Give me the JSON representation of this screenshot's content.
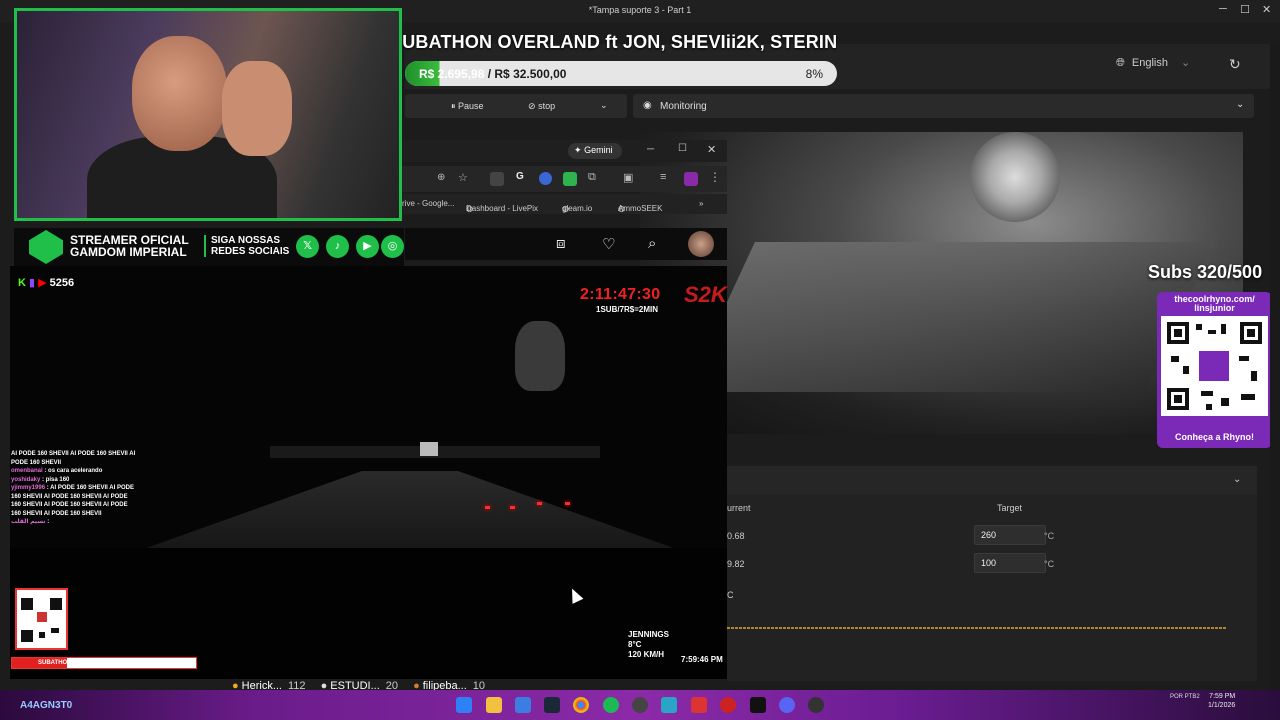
{
  "window": {
    "title": "*Tampa suporte 3 - Part 1",
    "minimize": "─",
    "maximize": "☐",
    "close": "✕"
  },
  "subathon": {
    "title": "SUBATHON OVERLAND ft JON, SHEVIii2K, STERIN",
    "raised": "R$ 2.695,98",
    "goal": " / R$ 32.500,00",
    "percent_label": "8%",
    "percent": 8
  },
  "app": {
    "language": "English",
    "pause_label": "Pause",
    "stop_label": "stop",
    "monitoring_label": "Monitoring",
    "temps": {
      "current_header": "urrent",
      "target_header": "Target",
      "rows": [
        {
          "current": "0.68",
          "target": "260",
          "unit": "°C"
        },
        {
          "current": "9.82",
          "target": "100",
          "unit": "°C"
        }
      ],
      "extra_unit": "C"
    }
  },
  "subs": {
    "label": "Subs 320/500"
  },
  "qr": {
    "url_line1": "thecoolrhyno.com/",
    "url_line2": "linsjunior",
    "cta": "Conheça a Rhyno!"
  },
  "browser": {
    "gemini_label": "Gemini",
    "bookmarks": [
      "rive - Google...",
      "Dashboard - LivePix",
      "gleam.io",
      "AmmoSEEK"
    ]
  },
  "banner": {
    "line1": "STREAMER OFICIAL",
    "line2": "GAMDOM IMPERIAL",
    "line3": "SIGA NOSSAS",
    "line4": "REDES SOCIAIS"
  },
  "stream": {
    "viewers": "5256",
    "timer": "2:11:47:30",
    "timer_rule": "1SUB/7R$=2MIN",
    "brand": "S2K",
    "location": "JENNINGS",
    "temperature": "8°C",
    "speed": "120 KM/H",
    "clock": "7:59:46 PM",
    "sub_bar": "SUBATHON (R$ 11.997,40/R$ 40.000,00)",
    "sub_bar_percent": 30,
    "chat": [
      {
        "user": "",
        "msg": "AI PODE 160 SHEVII AI PODE 160 SHEVII AI PODE 160 SHEVII"
      },
      {
        "user": "omenbanal",
        "msg": ": os cara acelerando"
      },
      {
        "user": "yoshidaky",
        "msg": ": pisa 160"
      },
      {
        "user": "yjimmy1996",
        "msg": ": AI PODE 160 SHEVII AI PODE 160 SHEVII AI PODE 160 SHEVII AI PODE 160 SHEVII AI PODE 160 SHEVII AI PODE 160 SHEVII AI PODE 160 SHEVII"
      },
      {
        "user": "نسيم القلب",
        "msg": ":"
      }
    ]
  },
  "leaderboard": [
    {
      "name": "Herick...",
      "count": "112"
    },
    {
      "name": "ESTUDI...",
      "count": "20"
    },
    {
      "name": "filipeba...",
      "count": "10"
    }
  ],
  "taskbar": {
    "user": "A4AGN3T0",
    "time": "7:59 PM",
    "date": "1/1/2026",
    "lang": "POR PTB2"
  },
  "colors": {
    "accent_green": "#1fbf4a",
    "kick_green": "#53fc18",
    "timer_red": "#e22222",
    "qr_purple": "#7b2ab8"
  }
}
